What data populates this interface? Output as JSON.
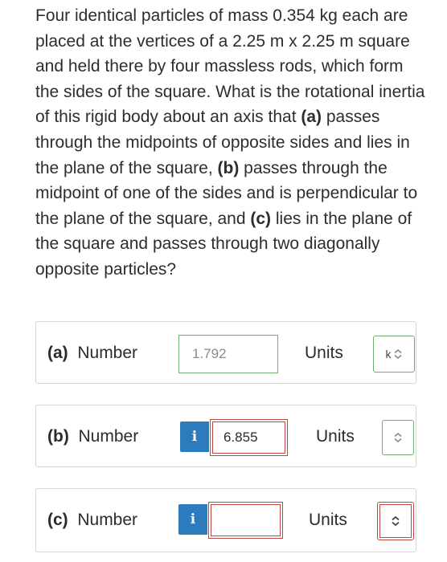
{
  "question": {
    "part1": "Four identical particles of mass 0.354 kg each are placed at the vertices of a 2.25 m x 2.25 m square and held there by four massless rods, which form the sides of the square. What is the rotational inertia of this rigid body about an axis that ",
    "a_tag": "(a)",
    "a_text": " passes through the midpoints of opposite sides and lies in the plane of the square, ",
    "b_tag": "(b)",
    "b_text": " passes through the midpoint of one of the sides and is perpendicular to the plane of the square, and ",
    "c_tag": "(c)",
    "c_text": " lies in the plane of the square and passes through two diagonally opposite particles?"
  },
  "parts": [
    {
      "tag": "(a)",
      "label": "Number",
      "value": "1.792",
      "units_label": "Units",
      "units_value": "k"
    },
    {
      "tag": "(b)",
      "label": "Number",
      "info": "i",
      "value": "6.855",
      "units_label": "Units",
      "units_value": ""
    },
    {
      "tag": "(c)",
      "label": "Number",
      "info": "i",
      "value": "",
      "units_label": "Units",
      "units_value": ""
    }
  ],
  "icons": {
    "chevron": "chevron-up-down-icon",
    "info": "info-icon"
  },
  "colors": {
    "correct": "#6fae6f",
    "incorrect": "#c2463f",
    "info": "#2b7bbd"
  }
}
